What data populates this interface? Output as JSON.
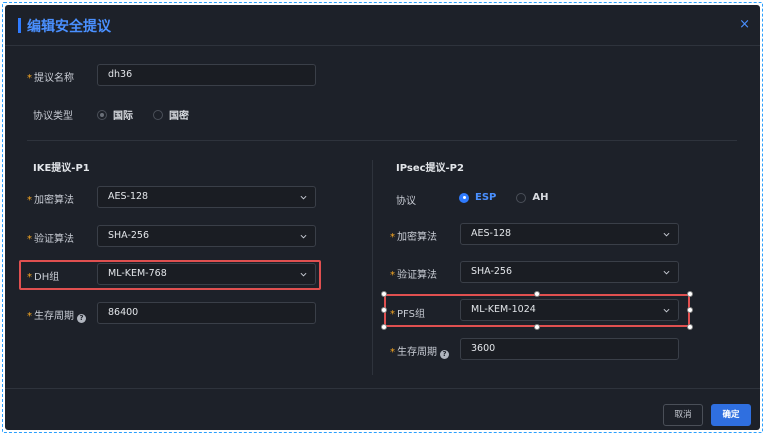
{
  "dialog": {
    "title": "编辑安全提议",
    "close_glyph": "×"
  },
  "proposal": {
    "name_label": "提议名称",
    "name_value": "dh36",
    "type_label": "协议类型",
    "type_options": [
      "国际",
      "国密"
    ],
    "type_selected": "国际"
  },
  "ike": {
    "section_title": "IKE提议-P1",
    "encryption_label": "加密算法",
    "encryption_value": "AES-128",
    "auth_label": "验证算法",
    "auth_value": "SHA-256",
    "dh_label": "DH组",
    "dh_value": "ML-KEM-768",
    "lifetime_label": "生存周期",
    "lifetime_value": "86400"
  },
  "ipsec": {
    "section_title": "IPsec提议-P2",
    "protocol_label": "协议",
    "protocol_options": [
      "ESP",
      "AH"
    ],
    "protocol_selected": "ESP",
    "encryption_label": "加密算法",
    "encryption_value": "AES-128",
    "auth_label": "验证算法",
    "auth_value": "SHA-256",
    "pfs_label": "PFS组",
    "pfs_value": "ML-KEM-1024",
    "lifetime_label": "生存周期",
    "lifetime_value": "3600"
  },
  "footer": {
    "cancel_label": "取消",
    "ok_label": "确定"
  },
  "icons": {
    "required_marker": "*",
    "help": "?"
  },
  "colors": {
    "accent": "#2f7bff",
    "highlight": "#e05050",
    "background": "#1d2129"
  }
}
